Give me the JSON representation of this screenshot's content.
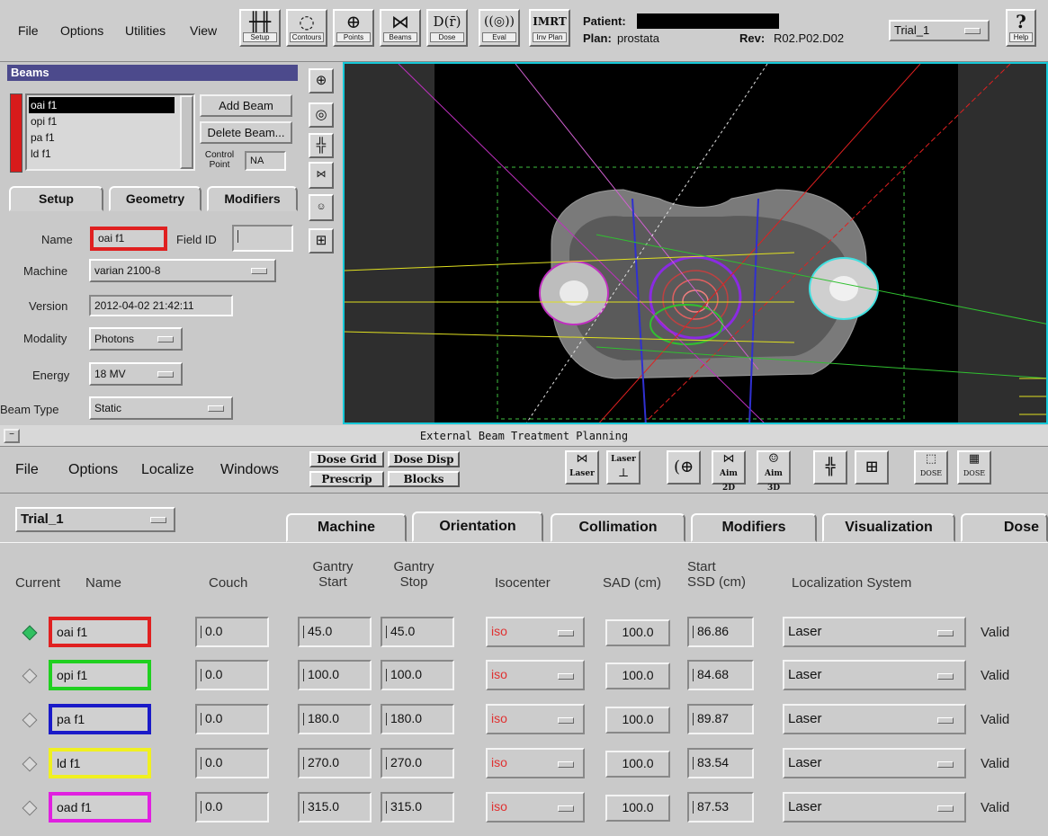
{
  "top_menu": [
    "File",
    "Options",
    "Utilities",
    "View"
  ],
  "toolbar": [
    {
      "icon": "setup-icon",
      "glyph": "╫╫",
      "label": "Setup"
    },
    {
      "icon": "contours-icon",
      "glyph": "◌",
      "label": "Contours"
    },
    {
      "icon": "points-icon",
      "glyph": "⊕",
      "label": "Points"
    },
    {
      "icon": "beams-icon",
      "glyph": "⋈",
      "label": "Beams"
    },
    {
      "icon": "dose-icon",
      "glyph": "D(r̄)",
      "label": "Dose"
    },
    {
      "icon": "eval-icon",
      "glyph": "((◎))",
      "label": "Eval"
    },
    {
      "icon": "invplan-icon",
      "glyph": "IMRT",
      "label": "Inv Plan"
    }
  ],
  "patient": {
    "label": "Patient:",
    "plan_label": "Plan:",
    "plan": "prostata",
    "rev_label": "Rev:",
    "rev": "R02.P02.D02"
  },
  "trial_select": "Trial_1",
  "help_label": "Help",
  "beams_panel": {
    "title": "Beams",
    "list": [
      "oai f1",
      "opi f1",
      "pa f1",
      "ld f1"
    ],
    "add_beam": "Add Beam",
    "delete_beam": "Delete Beam...",
    "control_point_label": "Control Point",
    "control_point_value": "NA",
    "tabs": [
      "Setup",
      "Geometry",
      "Modifiers"
    ],
    "fields": {
      "name_label": "Name",
      "name": "oai f1",
      "field_id_label": "Field ID",
      "machine_label": "Machine",
      "machine": "varian 2100-8",
      "version_label": "Version",
      "version": "2012-04-02 21:42:11",
      "modality_label": "Modality",
      "modality": "Photons",
      "energy_label": "Energy",
      "energy": "18 MV",
      "beam_type_label": "Beam Type",
      "beam_type": "Static"
    }
  },
  "side_icons": [
    "crosshair-icon",
    "contour-icon",
    "grid-icon",
    "aim2d-icon",
    "aim3d-icon",
    "target-icon"
  ],
  "lower_window": {
    "title": "External Beam Treatment Planning",
    "menu": [
      "File",
      "Options",
      "Localize",
      "Windows"
    ],
    "buttons": {
      "dose_grid": "Dose Grid",
      "dose_disp": "Dose Disp",
      "prescrip": "Prescrip",
      "blocks": "Blocks"
    },
    "icon_labels": [
      "Laser",
      "Laser",
      "",
      "Aim 2D",
      "Aim 3D",
      "",
      "",
      "DOSE",
      "DOSE"
    ],
    "trial": "Trial_1",
    "tabs": [
      "Machine",
      "Orientation",
      "Collimation",
      "Modifiers",
      "Visualization",
      "Dose"
    ],
    "headers": {
      "current": "Current",
      "name": "Name",
      "couch": "Couch",
      "gantry_start": "Gantry\nStart",
      "gantry_stop": "Gantry\nStop",
      "isocenter": "Isocenter",
      "sad": "SAD (cm)",
      "start_ssd": "Start\nSSD (cm)",
      "localization": "Localization System"
    },
    "rows": [
      {
        "name": "oai f1",
        "color": "#e02020",
        "couch": "0.0",
        "gantry_start": "45.0",
        "gantry_stop": "45.0",
        "iso": "iso",
        "sad": "100.0",
        "ssd": "86.86",
        "loc": "Laser",
        "status": "Valid",
        "current": true
      },
      {
        "name": "opi f1",
        "color": "#20d020",
        "couch": "0.0",
        "gantry_start": "100.0",
        "gantry_stop": "100.0",
        "iso": "iso",
        "sad": "100.0",
        "ssd": "84.68",
        "loc": "Laser",
        "status": "Valid",
        "current": false
      },
      {
        "name": "pa f1",
        "color": "#1a1ac8",
        "couch": "0.0",
        "gantry_start": "180.0",
        "gantry_stop": "180.0",
        "iso": "iso",
        "sad": "100.0",
        "ssd": "89.87",
        "loc": "Laser",
        "status": "Valid",
        "current": false
      },
      {
        "name": "ld f1",
        "color": "#f0f020",
        "couch": "0.0",
        "gantry_start": "270.0",
        "gantry_stop": "270.0",
        "iso": "iso",
        "sad": "100.0",
        "ssd": "83.54",
        "loc": "Laser",
        "status": "Valid",
        "current": false
      },
      {
        "name": "oad f1",
        "color": "#e020e0",
        "couch": "0.0",
        "gantry_start": "315.0",
        "gantry_stop": "315.0",
        "iso": "iso",
        "sad": "100.0",
        "ssd": "87.53",
        "loc": "Laser",
        "status": "Valid",
        "current": false
      }
    ]
  }
}
